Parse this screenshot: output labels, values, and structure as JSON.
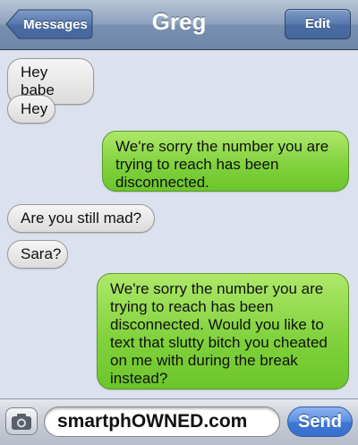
{
  "header": {
    "back_label": "Messages",
    "title": "Greg",
    "edit_label": "Edit"
  },
  "messages": [
    {
      "direction": "received",
      "text": "Hey babe"
    },
    {
      "direction": "received",
      "text": "Hey"
    },
    {
      "direction": "sent",
      "text": "We're sorry the number you are trying to reach has been disconnected."
    },
    {
      "direction": "received",
      "text": "Are you still mad?"
    },
    {
      "direction": "received",
      "text": "Sara?"
    },
    {
      "direction": "sent",
      "text": "We're sorry the number you are trying to reach has been disconnected. Would you like to text that slutty bitch you cheated on me with during the break instead?"
    }
  ],
  "compose": {
    "camera_icon": "camera-icon",
    "input_value": "smartphOWNED.com",
    "send_label": "Send"
  },
  "colors": {
    "sent_bubble": "#82d23e",
    "received_bubble": "#e6e6e6",
    "navbar": "#8ea2bd",
    "send_button": "#4a7fd9"
  }
}
